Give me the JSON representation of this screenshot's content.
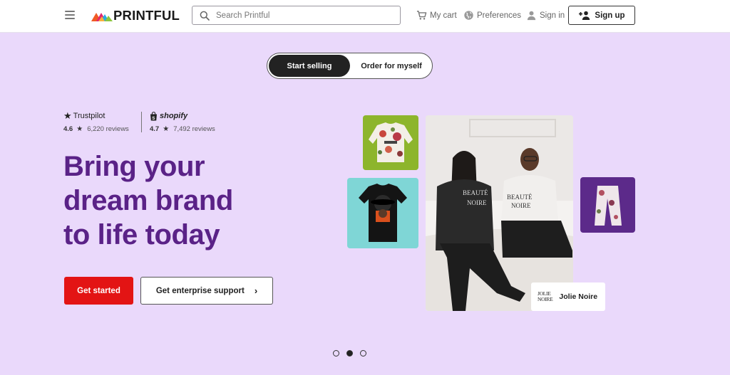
{
  "header": {
    "logo_text": "PRINTFUL",
    "search_placeholder": "Search Printful",
    "cart_label": "My cart",
    "preferences_label": "Preferences",
    "signin_label": "Sign in",
    "signup_label": "Sign up"
  },
  "toggle": {
    "active_label": "Start selling",
    "inactive_label": "Order for myself"
  },
  "ratings": {
    "trustpilot": {
      "brand": "Trustpilot",
      "score": "4.6",
      "reviews": "6,220 reviews"
    },
    "shopify": {
      "brand": "shopify",
      "score": "4.7",
      "reviews": "7,492 reviews"
    }
  },
  "hero": {
    "headline_line1": "Bring your",
    "headline_line2": "dream brand",
    "headline_line3": "to life today",
    "primary_cta": "Get started",
    "secondary_cta": "Get enterprise support"
  },
  "collage": {
    "brand_logo_line1": "JOLIE",
    "brand_logo_line2": "NOIRE",
    "brand_name": "Jolie Noire",
    "shirt_text_1": "BEAUTÉ",
    "shirt_text_2": "NOIRE"
  },
  "carousel": {
    "active_index": 1,
    "count": 3
  },
  "colors": {
    "background": "#ead9fb",
    "headline": "#5a2287",
    "primary_button": "#e31414",
    "sweater_tile": "#8db52c",
    "tshirt_tile": "#7fd6d6",
    "pants_tile": "#5c2a8a"
  },
  "icons": [
    "hamburger-icon",
    "printful-logo-icon",
    "search-icon",
    "cart-icon",
    "globe-icon",
    "user-icon",
    "add-user-icon",
    "star-icon",
    "shopify-bag-icon",
    "chevron-right-icon"
  ]
}
